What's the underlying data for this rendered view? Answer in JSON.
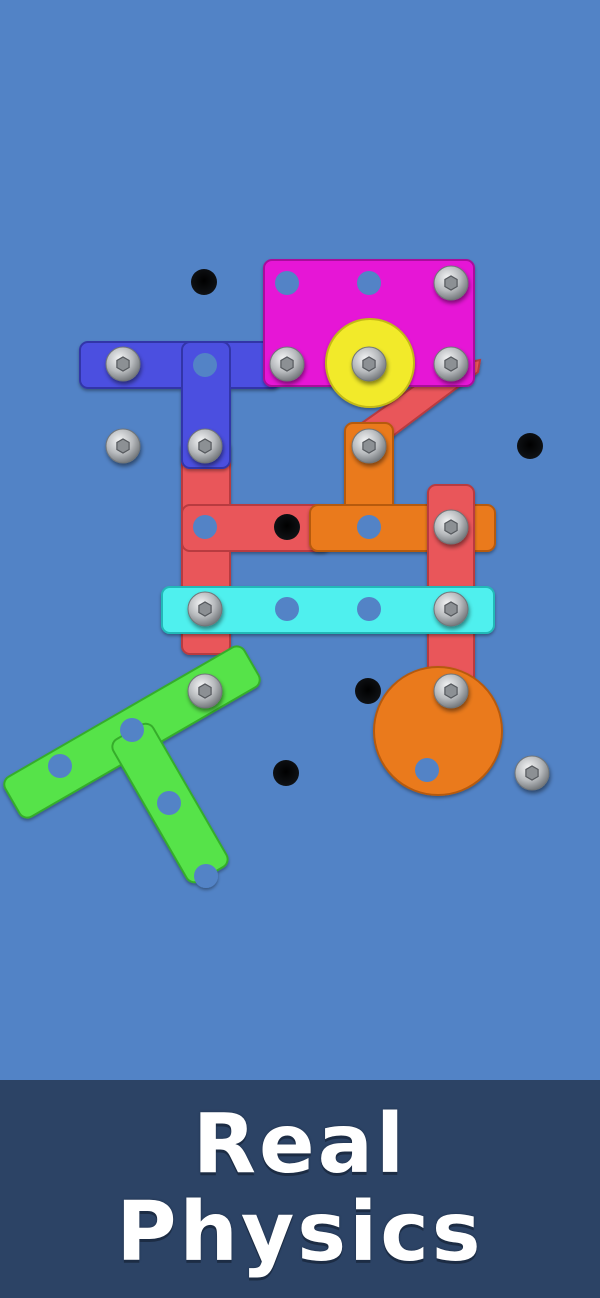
{
  "banner": {
    "line1": "Real",
    "line2": "Physics"
  },
  "colors": {
    "background": "#5283c6",
    "banner": "#2c4365",
    "magenta": "#e614d6",
    "blue": "#4b4fe0",
    "red": "#e9575a",
    "orange": "#ea7a1e",
    "cyan": "#4ff0ee",
    "green": "#57e34a",
    "yellow": "#f2ea2a",
    "screw": "#b9bcbf",
    "hole": "#05070b"
  }
}
